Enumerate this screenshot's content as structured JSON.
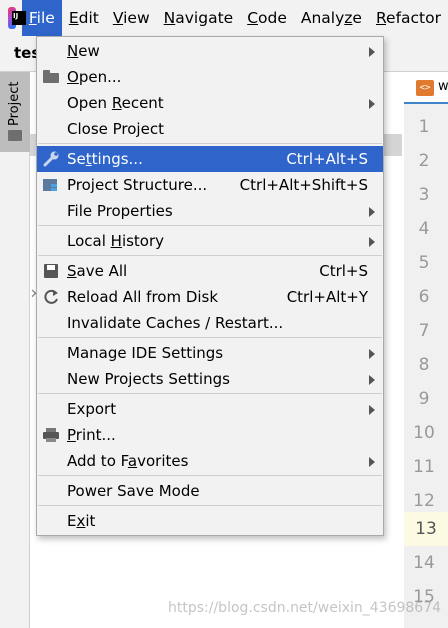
{
  "menubar": {
    "logo_text": "IJ",
    "items": [
      {
        "label": "File",
        "mnemonic": "F"
      },
      {
        "label": "Edit",
        "mnemonic": "E"
      },
      {
        "label": "View",
        "mnemonic": "V"
      },
      {
        "label": "Navigate",
        "mnemonic": "N"
      },
      {
        "label": "Code",
        "mnemonic": "C"
      },
      {
        "label": "Analyze",
        "mnemonic": ""
      },
      {
        "label": "Refactor",
        "mnemonic": "R"
      }
    ]
  },
  "project": {
    "title": "tes",
    "tool_window_label": "Project",
    "path_hint": "\\t"
  },
  "editor": {
    "tab_icon_text": "<>",
    "tab_name": "w",
    "line_numbers": [
      "1",
      "2",
      "3",
      "4",
      "5",
      "6",
      "7",
      "8",
      "9",
      "10",
      "11",
      "12",
      "13",
      "14",
      "15"
    ],
    "current_line": "13"
  },
  "file_menu": {
    "items": [
      {
        "label": "New",
        "shortcut": "",
        "submenu": true,
        "icon": ""
      },
      {
        "label": "Open...",
        "shortcut": "",
        "submenu": false,
        "icon": "folder-icon"
      },
      {
        "label": "Open Recent",
        "shortcut": "",
        "submenu": true,
        "icon": ""
      },
      {
        "label": "Close Project",
        "shortcut": "",
        "submenu": false,
        "icon": ""
      },
      {
        "label": "Settings...",
        "shortcut": "Ctrl+Alt+S",
        "submenu": false,
        "icon": "wrench-icon",
        "selected": true
      },
      {
        "label": "Project Structure...",
        "shortcut": "Ctrl+Alt+Shift+S",
        "submenu": false,
        "icon": "project-structure-icon"
      },
      {
        "label": "File Properties",
        "shortcut": "",
        "submenu": true,
        "icon": ""
      },
      {
        "label": "Local History",
        "shortcut": "",
        "submenu": true,
        "icon": ""
      },
      {
        "label": "Save All",
        "shortcut": "Ctrl+S",
        "submenu": false,
        "icon": "save-icon"
      },
      {
        "label": "Reload All from Disk",
        "shortcut": "Ctrl+Alt+Y",
        "submenu": false,
        "icon": "reload-icon"
      },
      {
        "label": "Invalidate Caches / Restart...",
        "shortcut": "",
        "submenu": false,
        "icon": ""
      },
      {
        "label": "Manage IDE Settings",
        "shortcut": "",
        "submenu": true,
        "icon": ""
      },
      {
        "label": "New Projects Settings",
        "shortcut": "",
        "submenu": true,
        "icon": ""
      },
      {
        "label": "Export",
        "shortcut": "",
        "submenu": true,
        "icon": ""
      },
      {
        "label": "Print...",
        "shortcut": "",
        "submenu": false,
        "icon": "print-icon"
      },
      {
        "label": "Add to Favorites",
        "shortcut": "",
        "submenu": true,
        "icon": ""
      },
      {
        "label": "Power Save Mode",
        "shortcut": "",
        "submenu": false,
        "icon": ""
      },
      {
        "label": "Exit",
        "shortcut": "",
        "submenu": false,
        "icon": ""
      }
    ]
  },
  "watermark": "https://blog.csdn.net/weixin_43698674",
  "colors": {
    "selection": "#2f65ca",
    "menu_bg": "#f2f2f2"
  }
}
